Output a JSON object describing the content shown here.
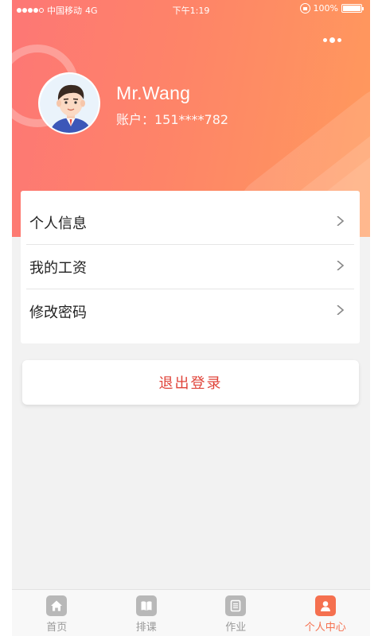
{
  "status_bar": {
    "carrier": "中国移动",
    "network": "4G",
    "time": "下午1:19",
    "battery": "100%"
  },
  "profile": {
    "name": "Mr.Wang",
    "account": "账户：151****782"
  },
  "menu": {
    "items": [
      {
        "label": "个人信息"
      },
      {
        "label": "我的工资"
      },
      {
        "label": "修改密码"
      }
    ]
  },
  "logout_label": "退出登录",
  "tabbar": {
    "tabs": [
      {
        "label": "首页",
        "icon": "home-icon",
        "active": false
      },
      {
        "label": "排课",
        "icon": "book-icon",
        "active": false
      },
      {
        "label": "作业",
        "icon": "document-icon",
        "active": false
      },
      {
        "label": "个人中心",
        "icon": "user-icon",
        "active": true
      }
    ]
  },
  "colors": {
    "header_start": "#fd7775",
    "header_end": "#ff9a5c",
    "accent": "#f5704f",
    "logout_text": "#e0443a"
  }
}
